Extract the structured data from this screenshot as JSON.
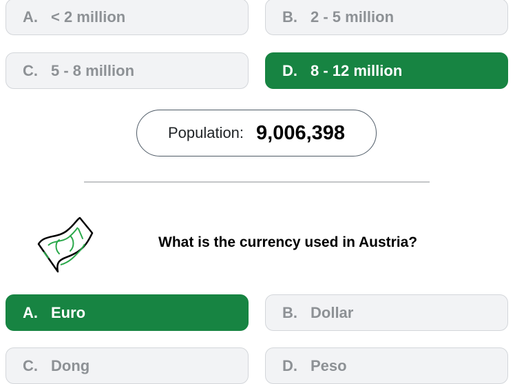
{
  "population_question": {
    "options": [
      {
        "letter": "A.",
        "text": "< 2 million",
        "selected": false
      },
      {
        "letter": "B.",
        "text": "2 - 5 million",
        "selected": false
      },
      {
        "letter": "C.",
        "text": "5 - 8 million",
        "selected": false
      },
      {
        "letter": "D.",
        "text": "8 - 12 million",
        "selected": true
      }
    ],
    "result_label": "Population:",
    "result_value": "9,006,398"
  },
  "currency_question": {
    "icon": "banknote-icon",
    "text": "What is the currency used in Austria?",
    "options": [
      {
        "letter": "A.",
        "text": "Euro",
        "selected": true
      },
      {
        "letter": "B.",
        "text": "Dollar",
        "selected": false
      },
      {
        "letter": "C.",
        "text": "Dong",
        "selected": false
      },
      {
        "letter": "D.",
        "text": "Peso",
        "selected": false
      }
    ]
  },
  "colors": {
    "selected": "#178442",
    "option_bg": "#f2f3f5",
    "option_text": "#8d9195"
  }
}
